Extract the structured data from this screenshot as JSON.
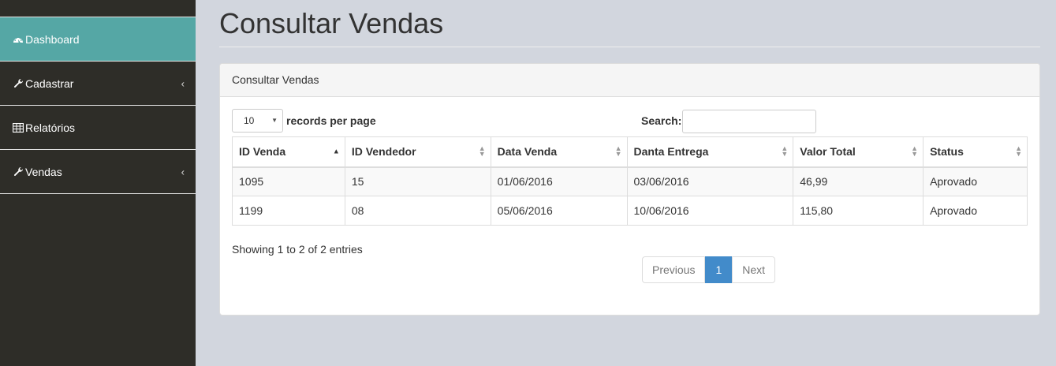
{
  "sidebar": {
    "items": [
      {
        "label": "Dashboard",
        "icon": "dashboard-icon",
        "active": true
      },
      {
        "label": "Cadastrar",
        "icon": "wrench-icon",
        "has_submenu": true
      },
      {
        "label": "Relatórios",
        "icon": "table-icon"
      },
      {
        "label": "Vendas",
        "icon": "wrench-icon",
        "has_submenu": true
      }
    ]
  },
  "page": {
    "title": "Consultar Vendas"
  },
  "panel": {
    "heading": "Consultar Vendas",
    "length_value": "10",
    "length_label": "records per page",
    "search_label": "Search:",
    "search_value": ""
  },
  "table": {
    "columns": [
      "ID Venda",
      "ID Vendedor",
      "Data Venda",
      "Danta Entrega",
      "Valor Total",
      "Status"
    ],
    "rows": [
      [
        "1095",
        "15",
        "01/06/2016",
        "03/06/2016",
        "46,99",
        "Aprovado"
      ],
      [
        "1199",
        "08",
        "05/06/2016",
        "10/06/2016",
        "115,80",
        "Aprovado"
      ]
    ]
  },
  "footer": {
    "info": "Showing 1 to 2 of 2 entries",
    "previous": "Previous",
    "current_page": "1",
    "next": "Next"
  },
  "colors": {
    "sidebar_bg": "#2e2d28",
    "active_bg": "#55a7a5",
    "page_bg": "#d2d6de",
    "pagination_active": "#428bca"
  }
}
